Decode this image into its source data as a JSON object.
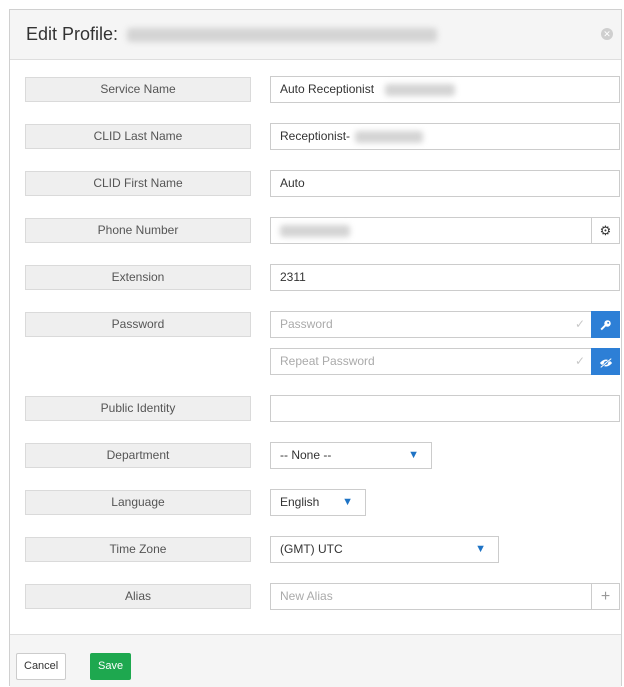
{
  "header": {
    "title": "Edit Profile:",
    "close_icon": "close-icon"
  },
  "fields": {
    "service_name": {
      "label": "Service Name",
      "value": "Auto Receptionist"
    },
    "clid_last_name": {
      "label": "CLID Last Name",
      "value": "Receptionist-"
    },
    "clid_first_name": {
      "label": "CLID First Name",
      "value": "Auto"
    },
    "phone_number": {
      "label": "Phone Number",
      "value": ""
    },
    "extension": {
      "label": "Extension",
      "value": "2311"
    },
    "password": {
      "label": "Password",
      "placeholder": "Password",
      "repeat_placeholder": "Repeat Password"
    },
    "public_identity": {
      "label": "Public Identity",
      "value": ""
    },
    "department": {
      "label": "Department",
      "value": "-- None --"
    },
    "language": {
      "label": "Language",
      "value": "English"
    },
    "time_zone": {
      "label": "Time Zone",
      "value": "(GMT) UTC"
    },
    "alias": {
      "label": "Alias",
      "placeholder": "New Alias"
    }
  },
  "footer": {
    "cancel_label": "Cancel",
    "save_label": "Save"
  },
  "colors": {
    "primary": "#2d7fd6",
    "success": "#1ea84f"
  }
}
